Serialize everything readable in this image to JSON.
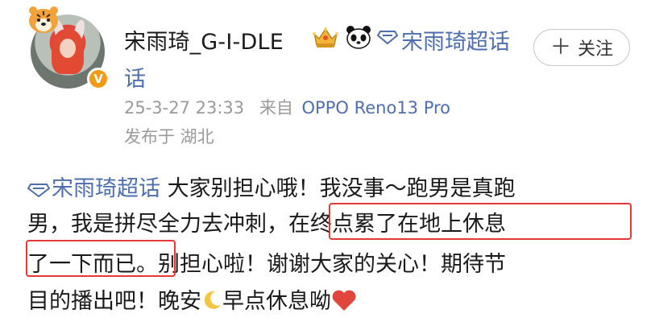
{
  "header": {
    "username": "宋雨琦_G-I-DLE",
    "topic_name": "宋雨琦超话",
    "follow_label": "关注"
  },
  "meta": {
    "timestamp": "25-3-27 23:33",
    "source_prefix": "来自",
    "device": "OPPO Reno13 Pro",
    "location_label": "发布于 湖北"
  },
  "post": {
    "topic_tag": "宋雨琦超话",
    "line1_text": "大家别担心哦！我没事～跑男是真跑",
    "line2_a": "男，我是拼尽全力去冲刺，",
    "line2_highlight": "在终点累了在地上休息",
    "line3_highlight": "了一下而已。",
    "line3_b": "别担心啦！谢谢大家的关心！期待节",
    "line4_a": "目的播出吧！晚安",
    "line4_b": "早点休息呦"
  },
  "icons": {
    "avatar_decoration": "tiger-icon",
    "verified": "verified-v-icon",
    "badge1": "crown-badge-icon",
    "badge2": "panda-icon",
    "topic": "diamond-chaohua-icon",
    "moon": "crescent-moon-icon",
    "heart": "red-heart-icon"
  },
  "colors": {
    "link_blue": "#4f6eae",
    "highlight_red": "#e53935",
    "verified_orange": "#f29a16",
    "meta_gray": "#9a9a9a"
  }
}
